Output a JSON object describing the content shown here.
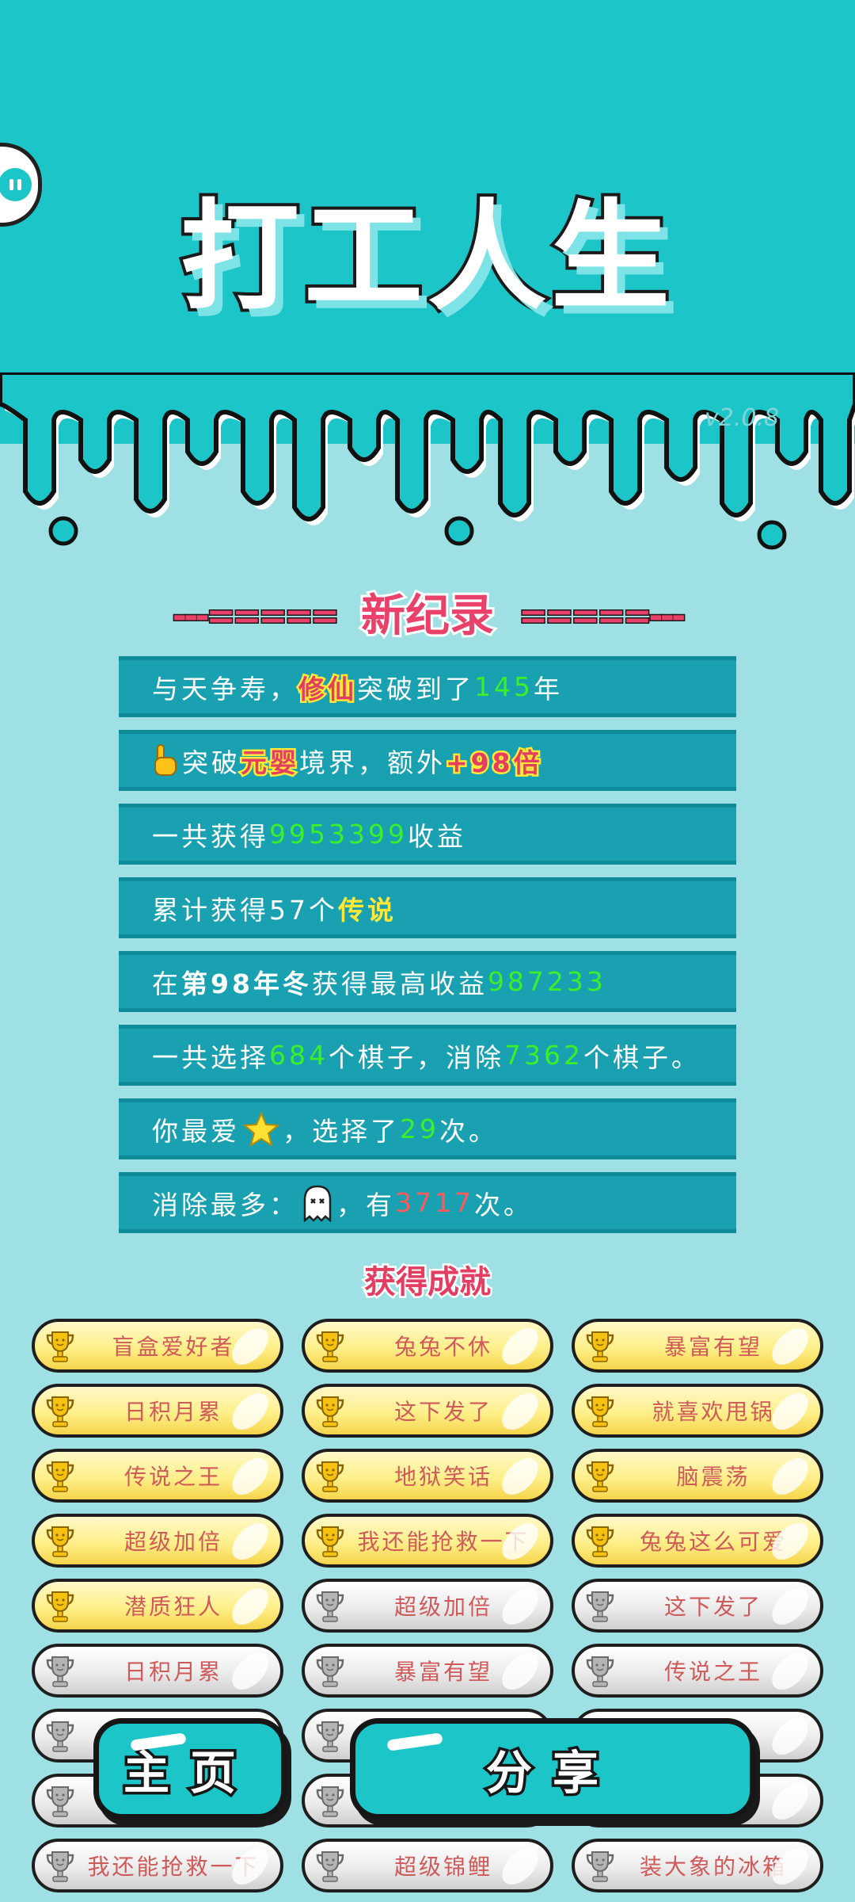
{
  "app": {
    "title": "打工人生",
    "version": "v2.0.8"
  },
  "record": {
    "dashes_left": "---=====",
    "dashes_right": "=====---",
    "title": "新纪录",
    "rows": [
      {
        "t1": "与天争寿，",
        "h1": "修仙",
        "t2": "突破到了",
        "n1": "145",
        "t3": "年"
      },
      {
        "t1": "突破",
        "h1": "元婴",
        "t2": "境界，额外",
        "h2": "+98倍"
      },
      {
        "t1": "一共获得",
        "n1": "9953399",
        "t2": "收益"
      },
      {
        "t1": "累计获得57个 ",
        "h1": "传说"
      },
      {
        "t1": "在 ",
        "h1": "第98年冬",
        "t2": " 获得最高收益",
        "n1": "987233"
      },
      {
        "t1": "一共选择",
        "n1": "684",
        "t2": "个棋子，消除",
        "n2": "7362",
        "t3": "个棋子。"
      },
      {
        "t1": "你最爱",
        "t2": "，选择了",
        "n1": "29",
        "t3": "次。"
      },
      {
        "t1": "消除最多：",
        "t2": "，有",
        "n1": "3717",
        "t3": "次。"
      }
    ]
  },
  "achievements": {
    "title": "获得成就",
    "items": [
      {
        "label": "盲盒爱好者",
        "tier": "gold"
      },
      {
        "label": "兔兔不休",
        "tier": "gold"
      },
      {
        "label": "暴富有望",
        "tier": "gold"
      },
      {
        "label": "日积月累",
        "tier": "gold"
      },
      {
        "label": "这下发了",
        "tier": "gold"
      },
      {
        "label": "就喜欢甩锅",
        "tier": "gold"
      },
      {
        "label": "传说之王",
        "tier": "gold"
      },
      {
        "label": "地狱笑话",
        "tier": "gold"
      },
      {
        "label": "脑震荡",
        "tier": "gold"
      },
      {
        "label": "超级加倍",
        "tier": "gold"
      },
      {
        "label": "我还能抢救一下",
        "tier": "gold"
      },
      {
        "label": "兔兔这么可爱",
        "tier": "gold"
      },
      {
        "label": "潜质狂人",
        "tier": "gold"
      },
      {
        "label": "超级加倍",
        "tier": "silver"
      },
      {
        "label": "这下发了",
        "tier": "silver"
      },
      {
        "label": "日积月累",
        "tier": "silver"
      },
      {
        "label": "暴富有望",
        "tier": "silver"
      },
      {
        "label": "传说之王",
        "tier": "silver"
      },
      {
        "label": "",
        "tier": "silver"
      },
      {
        "label": "",
        "tier": "silver"
      },
      {
        "label": "话",
        "tier": "silver"
      },
      {
        "label": "",
        "tier": "silver"
      },
      {
        "label": "",
        "tier": "silver"
      },
      {
        "label": "乐",
        "tier": "silver"
      },
      {
        "label": "我还能抢救一下",
        "tier": "silver"
      },
      {
        "label": "超级锦鲤",
        "tier": "silver"
      },
      {
        "label": "装大象的冰箱",
        "tier": "silver"
      }
    ]
  },
  "buttons": {
    "home": "主页",
    "share": "分享"
  },
  "colors": {
    "teal": "#1cc5c8",
    "light_bg": "#9fe0e4",
    "row_bg": "#1aa1b1",
    "accent_red": "#e33d61",
    "green": "#39f02a"
  }
}
